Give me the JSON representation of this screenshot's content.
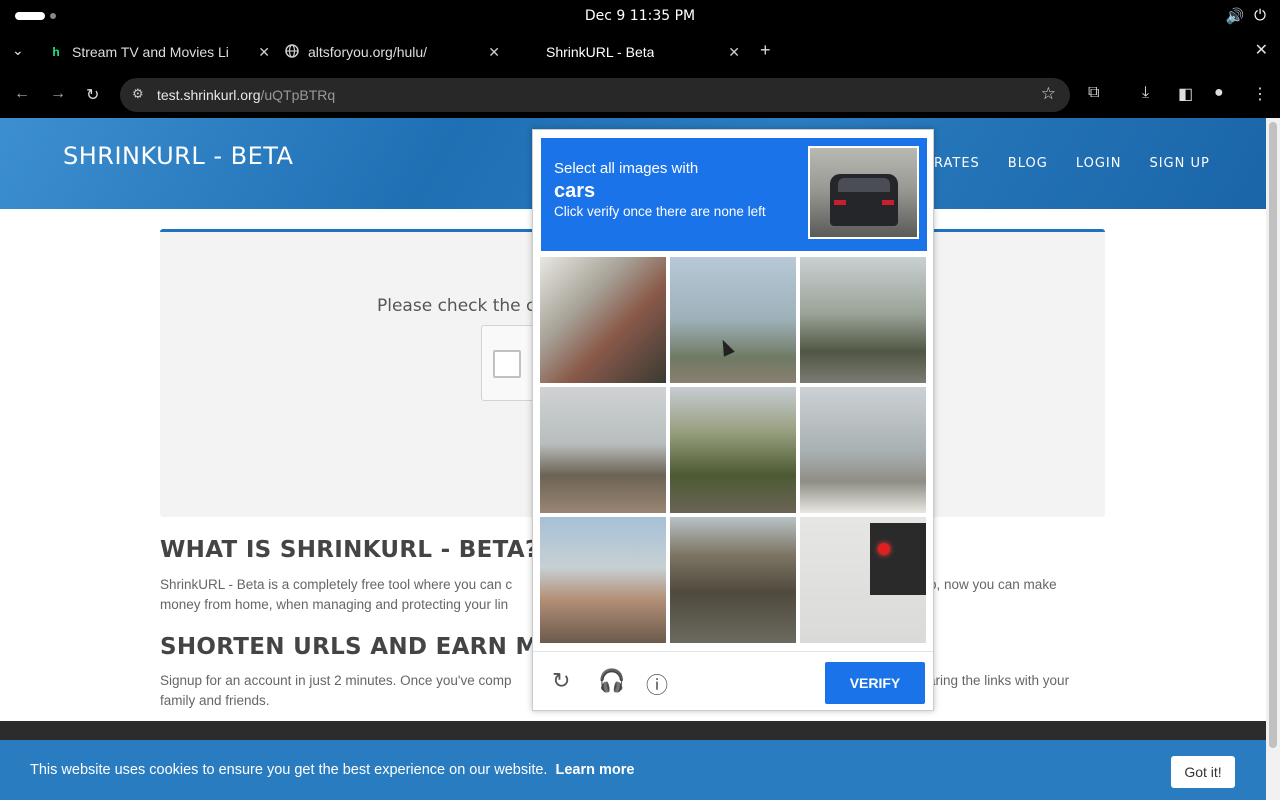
{
  "os": {
    "clock": "Dec 9  11:35 PM",
    "icons": [
      "volume-icon",
      "power-icon"
    ]
  },
  "browser": {
    "tabs": [
      {
        "title": "Stream TV and Movies Li",
        "favicon": "h",
        "active": false
      },
      {
        "title": "altsforyou.org/hulu/",
        "favicon": "globe-icon",
        "active": false
      },
      {
        "title": "ShrinkURL - Beta",
        "favicon": "",
        "active": true
      }
    ],
    "url_domain": "test.shrinkurl.org",
    "url_path": "/uQTpBTRq"
  },
  "site": {
    "logo": "SHRINKURL - BETA",
    "nav": [
      "RATES",
      "BLOG",
      "LOGIN",
      "SIGN UP"
    ],
    "check_text": "Please check the ca",
    "section1": {
      "heading": "WHAT IS SHRINKURL - BETA?",
      "text_line1": "ShrinkURL - Beta is a completely free tool where you can c",
      "text_line1_right": "o, now you can make",
      "text_line2": "money from home, when managing and protecting your lin"
    },
    "section2": {
      "heading": "SHORTEN URLS AND EARN MO",
      "text_line1": "Signup for an account in just 2 minutes. Once you've comp",
      "text_line1_right": "aring the links with your",
      "text_line2": "family and friends."
    }
  },
  "captcha": {
    "instruction": "Select all images with",
    "target_word": "cars",
    "sub_instruction": "Click verify once there are none left",
    "tiles": [
      "stairs",
      "palm-trees",
      "palm-trees-building",
      "street-wall",
      "palm-tree",
      "traffic-light-pole",
      "roof-palms",
      "building",
      "traffic-light"
    ],
    "verify_label": "VERIFY",
    "footer_icons": [
      "reload-icon",
      "audio-icon",
      "info-icon"
    ]
  },
  "cookie": {
    "text": "This website uses cookies to ensure you get the best experience on our website.",
    "learn_more": "Learn more",
    "button": "Got it!"
  },
  "colors": {
    "brand_blue": "#1a73e8",
    "header_blue": "#1f6fb4",
    "cookie_blue": "#2a7cc0"
  }
}
